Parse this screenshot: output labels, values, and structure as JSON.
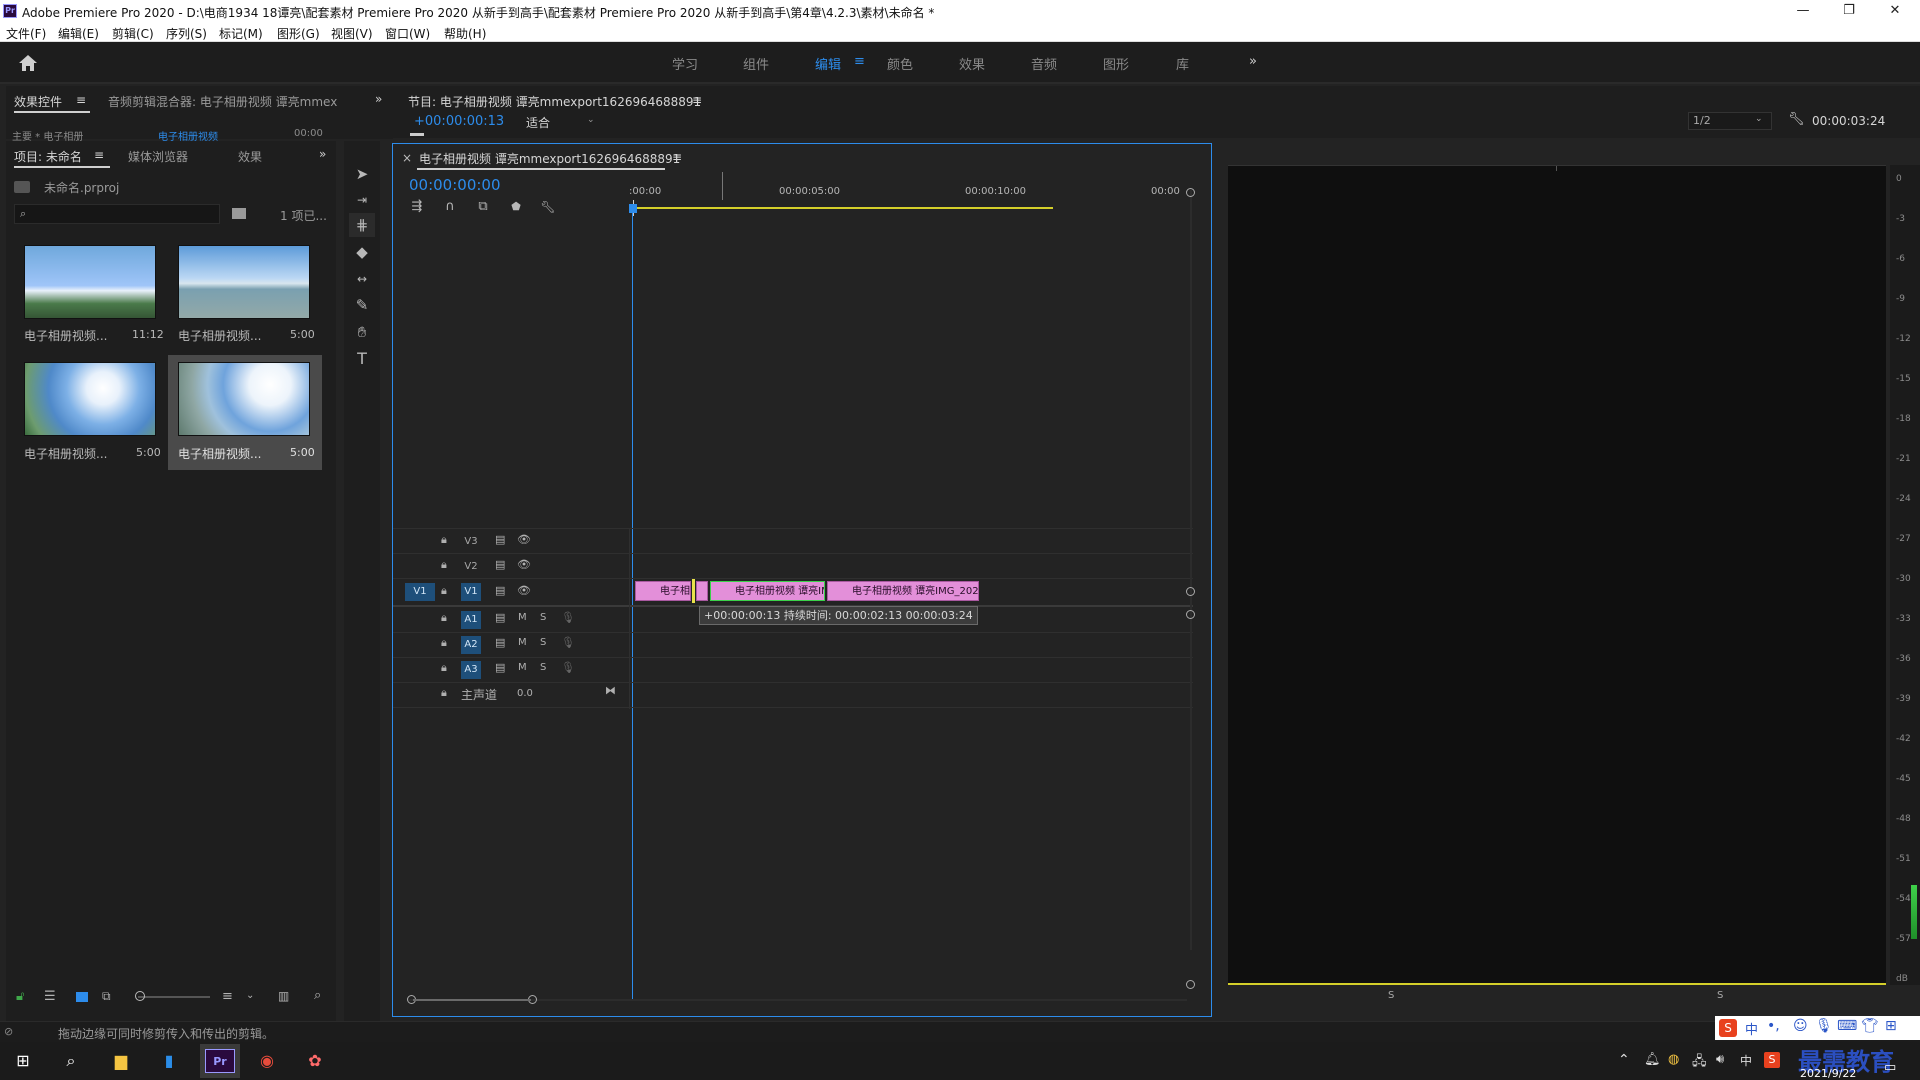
{
  "window": {
    "app_icon": "Pr",
    "title": "Adobe Premiere Pro 2020 - D:\\电商1934 18谭亮\\配套素材 Premiere Pro 2020 从新手到高手\\配套素材 Premiere Pro 2020 从新手到高手\\第4章\\4.2.3\\素材\\未命名 *",
    "minimize": "—",
    "maximize": "❐",
    "close": "✕"
  },
  "menu": [
    "文件(F)",
    "编辑(E)",
    "剪辑(C)",
    "序列(S)",
    "标记(M)",
    "图形(G)",
    "视图(V)",
    "窗口(W)",
    "帮助(H)"
  ],
  "workspaces": {
    "items": [
      "学习",
      "组件",
      "编辑",
      "颜色",
      "效果",
      "音频",
      "图形",
      "库"
    ],
    "active": "编辑",
    "active_menu_icon": "≡",
    "more": "»"
  },
  "source_panel": {
    "tabs": [
      "效果控件",
      "音频剪辑混合器: 电子相册视频 谭亮mmex"
    ],
    "tab_menu": "≡",
    "more": "»",
    "sub_left": "主要 * 电子相册",
    "sub_mid": "电子相册视频",
    "sub_time": "00:00"
  },
  "project_panel": {
    "tabs": [
      "项目: 未命名",
      "媒体浏览器",
      "效果"
    ],
    "tab_menu": "≡",
    "more": "»",
    "file": "未命名.prproj",
    "search_placeholder": "",
    "item_count": "1 项已...",
    "items": [
      {
        "label": "电子相册视频...",
        "duration": "11:12"
      },
      {
        "label": "电子相册视频...",
        "duration": "5:00"
      },
      {
        "label": "电子相册视频...",
        "duration": "5:00"
      },
      {
        "label": "电子相册视频...",
        "duration": "5:00"
      }
    ]
  },
  "program_monitor": {
    "title": "节目: 电子相册视频 谭亮mmexport1626964688891",
    "menu": "≡",
    "timecode": "+00:00:00:13",
    "fit": "适合",
    "resolution": "1/2",
    "duration": "00:00:03:24",
    "settings_icon": "wrench-icon"
  },
  "timeline": {
    "close": "×",
    "title": "电子相册视频 谭亮mmexport1626964688891",
    "menu": "≡",
    "timecode": "00:00:00:00",
    "ruler": [
      ":00:00",
      "00:00:05:00",
      "00:00:10:00",
      "00:00"
    ],
    "video_tracks": [
      "V3",
      "V2",
      "V1"
    ],
    "audio_tracks": [
      "A1",
      "A2",
      "A3"
    ],
    "source_patch_v": "V1",
    "mute": "M",
    "solo": "S",
    "master_label": "主声道",
    "master_value": "0.0",
    "clips": [
      "电子相",
      "电子相册视频 谭亮IMG_202",
      "电子相册视频 谭亮IMG_2021072"
    ],
    "tooltip": "+00:00:00:13 持续时间: 00:00:02:13 00:00:03:24"
  },
  "meter": {
    "ticks": [
      "0",
      "-3",
      "-6",
      "-9",
      "-12",
      "-15",
      "-18",
      "-21",
      "-24",
      "-27",
      "-30",
      "-33",
      "-36",
      "-39",
      "-42",
      "-45",
      "-48",
      "-51",
      "-54",
      "-57",
      "dB"
    ],
    "solo_left": "S",
    "solo_right": "S"
  },
  "status": {
    "text": "拖动边缘可同时修剪传入和传出的剪辑。"
  },
  "taskbar": {
    "ime": "中",
    "date": "2021/9/22",
    "watermark": "最需教育"
  }
}
